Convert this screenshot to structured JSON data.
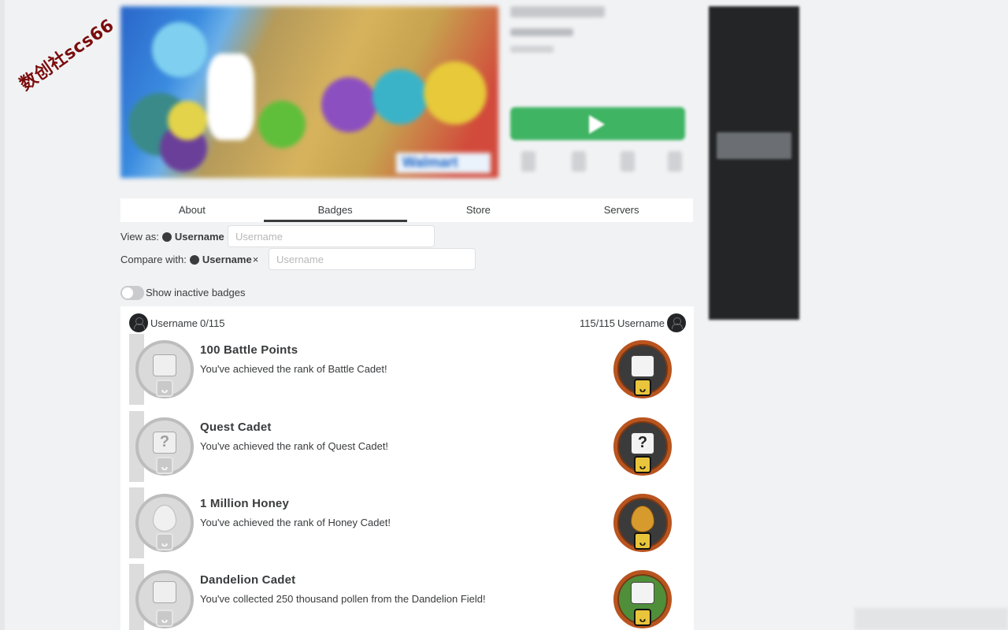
{
  "watermark": "数创社scs66",
  "thumbnail_brand": "Walmart",
  "tabs": [
    {
      "label": "About"
    },
    {
      "label": "Badges"
    },
    {
      "label": "Store"
    },
    {
      "label": "Servers"
    }
  ],
  "active_tab": "Badges",
  "view_as": {
    "label": "View as:",
    "username": "Username",
    "placeholder": "Username"
  },
  "compare_with": {
    "label": "Compare with:",
    "username": "Username",
    "clear": "×",
    "placeholder": "Username"
  },
  "inactive_toggle": {
    "label": "Show inactive badges",
    "on": false
  },
  "progress": {
    "left_user": "Username",
    "left_count": "0/115",
    "right_count": "115/115",
    "right_user": "Username"
  },
  "badges": [
    {
      "title": "100 Battle Points",
      "description": "You've achieved the rank of Battle Cadet!",
      "icon": "panda-icon"
    },
    {
      "title": "Quest Cadet",
      "description": "You've achieved the rank of Quest Cadet!",
      "icon": "quest-map-icon"
    },
    {
      "title": "1 Million Honey",
      "description": "You've achieved the rank of Honey Cadet!",
      "icon": "honey-drop-icon"
    },
    {
      "title": "Dandelion Cadet",
      "description": "You've collected 250 thousand pollen from the Dandelion Field!",
      "icon": "dandelion-field-icon"
    }
  ],
  "colors": {
    "play_button": "#3fb463",
    "bronze": "#b9541f",
    "text": "#393b3d"
  }
}
